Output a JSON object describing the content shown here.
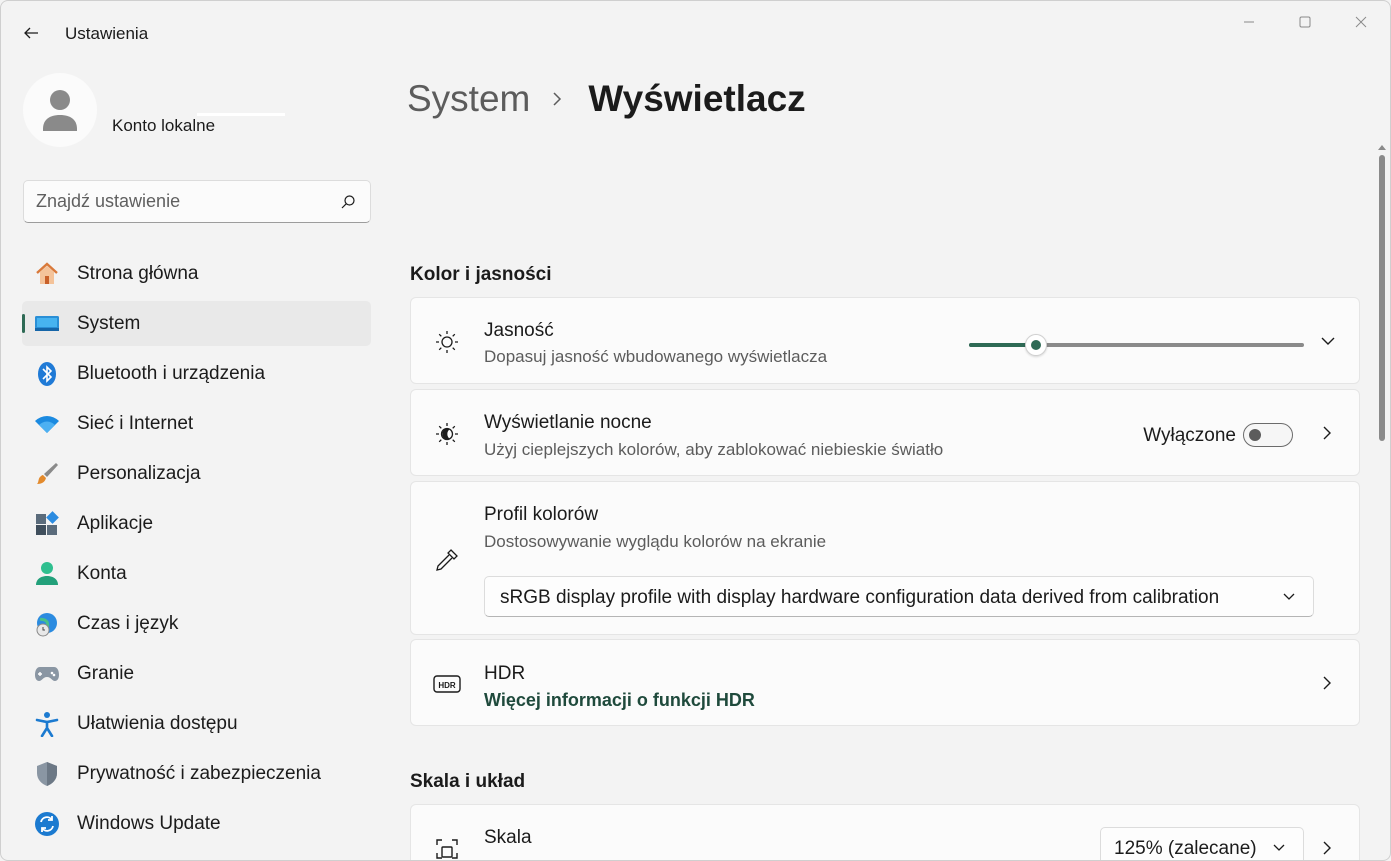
{
  "window": {
    "title": "Ustawienia"
  },
  "account": {
    "name": "Konto lokalne"
  },
  "search": {
    "placeholder": "Znajdź ustawienie"
  },
  "sidebar": {
    "items": [
      {
        "label": "Strona główna",
        "icon": "home-icon",
        "selected": false
      },
      {
        "label": "System",
        "icon": "system-icon",
        "selected": true
      },
      {
        "label": "Bluetooth i urządzenia",
        "icon": "bluetooth-icon",
        "selected": false
      },
      {
        "label": "Sieć i Internet",
        "icon": "wifi-icon",
        "selected": false
      },
      {
        "label": "Personalizacja",
        "icon": "brush-icon",
        "selected": false
      },
      {
        "label": "Aplikacje",
        "icon": "apps-icon",
        "selected": false
      },
      {
        "label": "Konta",
        "icon": "accounts-icon",
        "selected": false
      },
      {
        "label": "Czas i język",
        "icon": "time-language-icon",
        "selected": false
      },
      {
        "label": "Granie",
        "icon": "gamepad-icon",
        "selected": false
      },
      {
        "label": "Ułatwienia dostępu",
        "icon": "accessibility-icon",
        "selected": false
      },
      {
        "label": "Prywatność i zabezpieczenia",
        "icon": "shield-icon",
        "selected": false
      },
      {
        "label": "Windows Update",
        "icon": "update-icon",
        "selected": false
      }
    ]
  },
  "breadcrumb": {
    "parent": "System",
    "current": "Wyświetlacz"
  },
  "sections": {
    "color_brightness": "Kolor i jasności",
    "scale_layout": "Skala i układ"
  },
  "brightness": {
    "title": "Jasność",
    "subtitle": "Dopasuj jasność wbudowanego wyświetlacza",
    "level": 0.2
  },
  "night_light": {
    "title": "Wyświetlanie nocne",
    "subtitle": "Użyj cieplejszych kolorów, aby zablokować niebieskie światło",
    "state": "Wyłączone",
    "on": false
  },
  "color_profile": {
    "title": "Profil kolorów",
    "subtitle": "Dostosowywanie wyglądu kolorów na ekranie",
    "selected": "sRGB display profile with display hardware configuration data derived from calibration"
  },
  "hdr": {
    "title": "HDR",
    "link": "Więcej informacji o funkcji HDR"
  },
  "scale": {
    "title": "Skala",
    "value": "125% (zalecane)"
  },
  "colors": {
    "accent": "#2e6a55",
    "link": "#1f4a3c",
    "background": "#f3f3f3",
    "card": "#fbfbfb"
  }
}
